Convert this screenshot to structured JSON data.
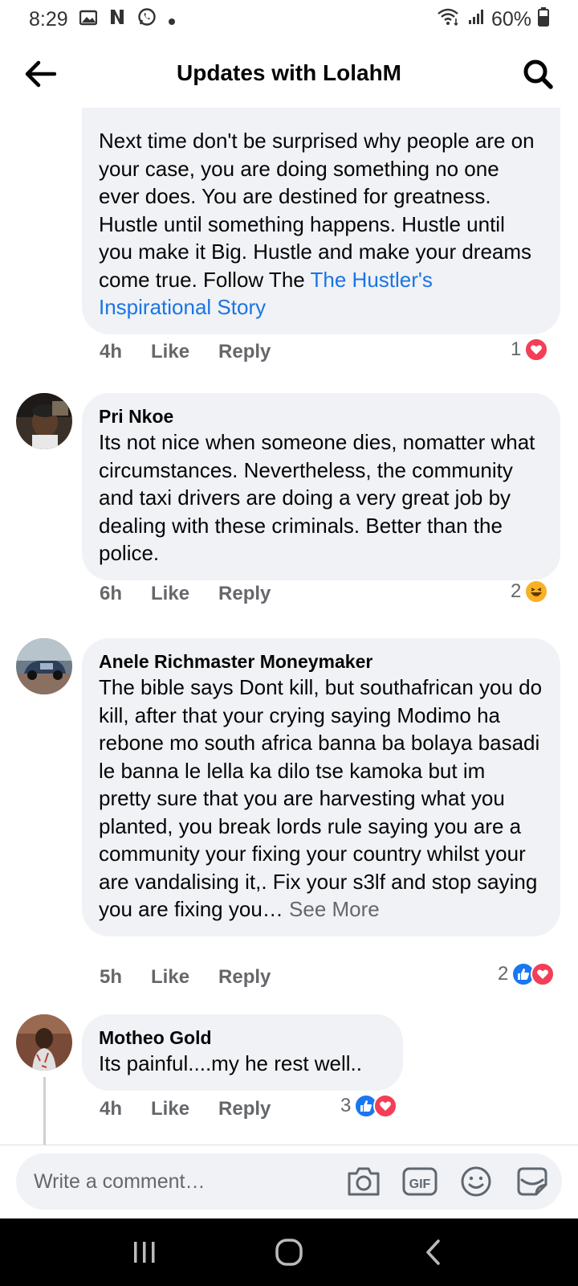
{
  "status_bar": {
    "time": "8:29",
    "battery": "60%",
    "icons_left": [
      "gallery-icon",
      "netflix-icon",
      "whatsapp-icon",
      "dot-icon"
    ],
    "icons_right": [
      "wifi-icon",
      "signal-icon",
      "battery-icon"
    ]
  },
  "header": {
    "title": "Updates with LolahM"
  },
  "comments": [
    {
      "author": "",
      "text": "Next time don't be surprised why people are on your case, you are doing something no one ever does. You are destined for greatness. Hustle until something happens. Hustle until you make it Big. Hustle and make your dreams come true. Follow The",
      "link_text": "The Hustler's Inspirational Story",
      "time": "4h",
      "like": "Like",
      "reply": "Reply",
      "reaction_count": "1",
      "reactions": [
        "love"
      ]
    },
    {
      "author": "Pri Nkoe",
      "text": "Its not nice when someone dies, nomatter what circumstances. Nevertheless, the community and taxi drivers are doing a very great job by dealing with these criminals. Better than the police.",
      "time": "6h",
      "like": "Like",
      "reply": "Reply",
      "reaction_count": "2",
      "reactions": [
        "haha"
      ]
    },
    {
      "author": "Anele Richmaster Moneymaker",
      "text": "The bible says Dont kill, but southafrican you do kill, after that your crying saying  Modimo ha rebone mo south africa  banna ba bolaya basadi le banna  le lella ka dilo tse kamoka but  im pretty sure that you are harvesting what you planted, you break lords rule saying you are a community your fixing your country whilst your are vandalising it,. Fix your s3lf and stop saying you are fixing you…",
      "see_more": "See More",
      "time": "5h",
      "like": "Like",
      "reply": "Reply",
      "reaction_count": "2",
      "reactions": [
        "like",
        "love"
      ]
    },
    {
      "author": "Motheo Gold",
      "text": "Its painful....my he rest well..",
      "time": "4h",
      "like": "Like",
      "reply": "Reply",
      "reaction_count": "3",
      "reactions": [
        "like",
        "love"
      ]
    }
  ],
  "composer": {
    "placeholder": "Write a comment…",
    "icons": [
      "camera-icon",
      "gif-icon",
      "emoji-icon",
      "sticker-icon"
    ]
  },
  "colors": {
    "bubble": "#f0f2f5",
    "link": "#1b74e4",
    "like_blue": "#1877f2",
    "love_red": "#f33e58",
    "haha_yellow": "#f7b125",
    "meta_gray": "#65676b"
  }
}
